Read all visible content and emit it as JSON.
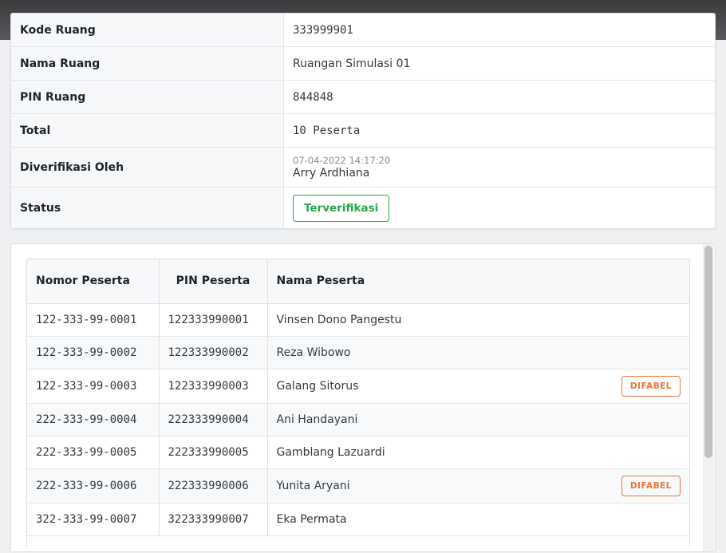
{
  "room": {
    "kode_label": "Kode Ruang",
    "kode_value": "333999901",
    "nama_label": "Nama Ruang",
    "nama_value": "Ruangan Simulasi 01",
    "pin_label": "PIN Ruang",
    "pin_value": "844848",
    "total_label": "Total",
    "total_value": "10 Peserta",
    "verified_label": "Diverifikasi Oleh",
    "verified_time": "07-04-2022 14:17:20",
    "verified_name": "Arry Ardhiana",
    "status_label": "Status",
    "status_value": "Terverifikasi"
  },
  "participants": {
    "headers": [
      "Nomor Peserta",
      "PIN Peserta",
      "Nama Peserta"
    ],
    "badge_label": "DIFABEL",
    "rows": [
      {
        "nomor": "122-333-99-0001",
        "pin": "122333990001",
        "nama": "Vinsen Dono Pangestu",
        "difabel": false
      },
      {
        "nomor": "122-333-99-0002",
        "pin": "122333990002",
        "nama": "Reza Wibowo",
        "difabel": false
      },
      {
        "nomor": "122-333-99-0003",
        "pin": "122333990003",
        "nama": "Galang Sitorus",
        "difabel": true
      },
      {
        "nomor": "222-333-99-0004",
        "pin": "222333990004",
        "nama": "Ani Handayani",
        "difabel": false
      },
      {
        "nomor": "222-333-99-0005",
        "pin": "222333990005",
        "nama": "Gamblang Lazuardi",
        "difabel": false
      },
      {
        "nomor": "222-333-99-0006",
        "pin": "222333990006",
        "nama": "Yunita Aryani",
        "difabel": true
      },
      {
        "nomor": "322-333-99-0007",
        "pin": "322333990007",
        "nama": "Eka Permata",
        "difabel": false
      }
    ]
  },
  "colors": {
    "status_green": "#28a745",
    "difabel_orange": "#e8763a"
  }
}
